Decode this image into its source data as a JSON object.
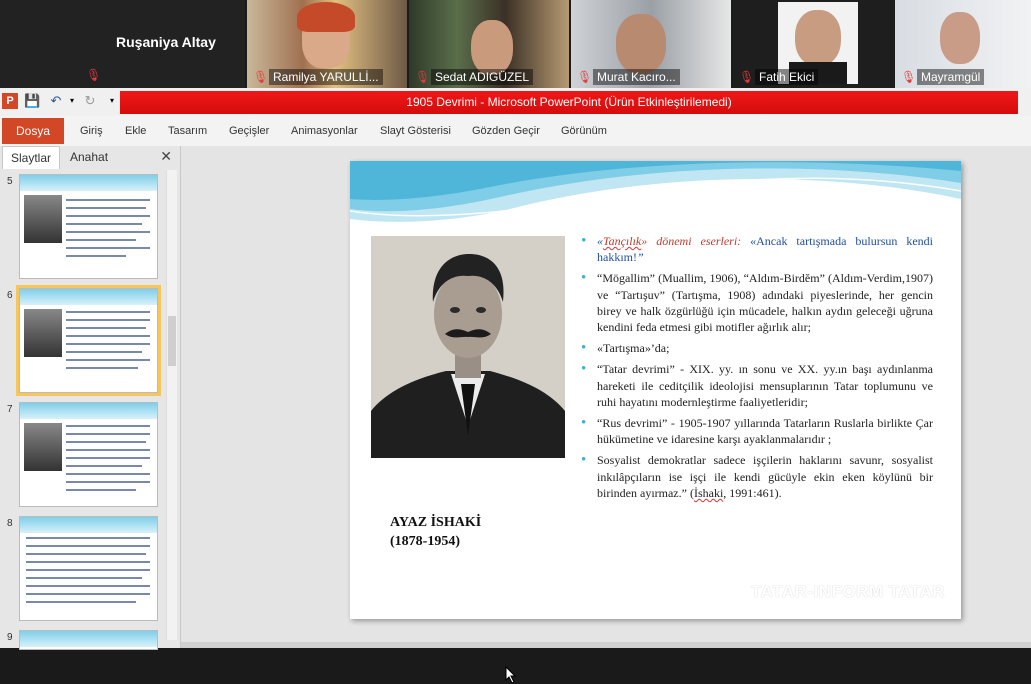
{
  "video": {
    "tiles": [
      {
        "name": "Ruşaniya Altay"
      },
      {
        "name": "Ramilya YARULLİ..."
      },
      {
        "name": "Sedat ADIGÜZEL"
      },
      {
        "name": "Murat Kacıro..."
      },
      {
        "name": "Fatih Ekici"
      },
      {
        "name": "Mayramgül"
      }
    ]
  },
  "window": {
    "title": "1905 Devrimi  -  Microsoft PowerPoint (Ürün Etkinleştirilemedi)"
  },
  "ribbon": {
    "file": "Dosya",
    "tabs": [
      "Giriş",
      "Ekle",
      "Tasarım",
      "Geçişler",
      "Animasyonlar",
      "Slayt Gösterisi",
      "Gözden Geçir",
      "Görünüm"
    ]
  },
  "panel": {
    "tab_slides": "Slaytlar",
    "tab_outline": "Anahat",
    "close": "✕",
    "slide_numbers": [
      "5",
      "6",
      "7",
      "8",
      "9"
    ]
  },
  "slide": {
    "caption_name": "AYAZ İSHAKİ",
    "caption_years": "(1878-1954)",
    "b1_a": "«",
    "b1_b": "Tançılık",
    "b1_c": "» dönemi eserleri: ",
    "b1_d": "«Ancak tartışmada bulursun kendi hakkım!",
    "b1_e": "”",
    "b2": "“Mögallim” (Muallim, 1906), “Aldım-Birdĕm” (Aldım-Verdim,1907) ve “Tartışuv” (Tartışma, 1908) adındaki piyeslerinde, her gencin birey ve halk özgürlüğü için mücadele, halkın aydın geleceği uğruna kendini feda etmesi gibi motifler ağırlık alır;",
    "b3": "«Tartışma»’da;",
    "b4": "“Tatar devrimi” -  XIX. yy. ın sonu ve XX. yy.ın başı aydınlanma hareketi ile ceditçilik ideolojisi mensuplarının Tatar toplumunu ve ruhi hayatını modernleştirme faaliyetleridir;",
    "b5": "“Rus devrimi” - 1905-1907 yıllarında Tatarların Ruslarla birlikte Çar hükümetine ve idaresine karşı ayaklanmalarıdır ;",
    "b6_a": "Sosyalist demokratlar sadece işçilerin haklarını savunr, sosyalist inkılâpçıların ise işçi ile kendi gücüyle ekin eken köylünü bir birinden ayırmaz.” (",
    "b6_b": "İshaki",
    "b6_c": ", 1991:461).",
    "watermark": "TATAR-INFORM TATAR"
  }
}
